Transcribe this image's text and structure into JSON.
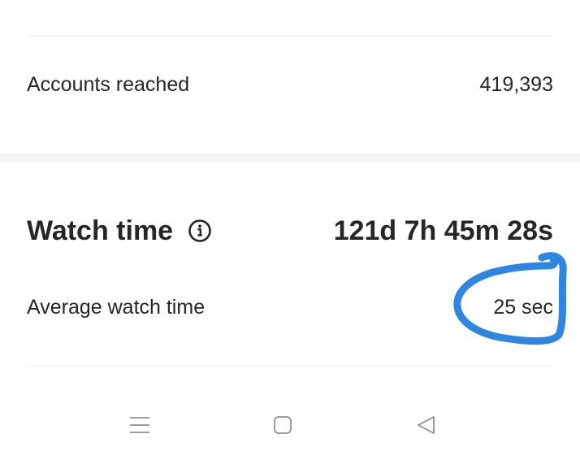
{
  "reach": {
    "label": "Accounts reached",
    "value": "419,393"
  },
  "watch_time": {
    "title": "Watch time",
    "info_icon": "info-circle-icon",
    "total": "121d 7h 45m 28s",
    "average_label": "Average watch time",
    "average_value": "25 sec"
  },
  "annotation": {
    "color": "#2f86e0",
    "shape": "hand-drawn circle"
  },
  "system_nav": {
    "items": [
      {
        "icon": "menu-lines-icon"
      },
      {
        "icon": "home-square-icon"
      },
      {
        "icon": "back-triangle-icon"
      }
    ]
  }
}
